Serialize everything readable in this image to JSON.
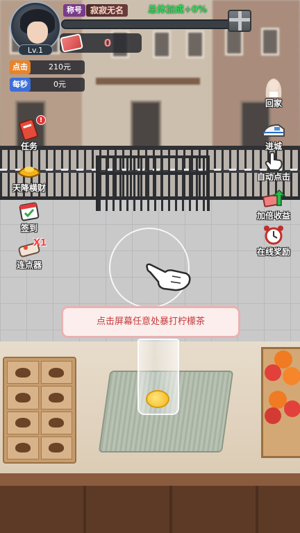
{
  "player": {
    "title_tag": "称号",
    "name": "寂寂无名",
    "level": "Lv.1",
    "total_bonus": "总体加成+0%",
    "xp_progress": 0
  },
  "currency": {
    "cash_value": "0"
  },
  "stats": {
    "click_label": "点击",
    "click_value": "210元",
    "per_second_label": "每秒",
    "per_second_value": "0元"
  },
  "left_menu": [
    {
      "label": "任务",
      "icon": "task-scroll-icon",
      "badge": "!"
    },
    {
      "label": "天降横财",
      "icon": "gold-ingot-icon"
    },
    {
      "label": "签到",
      "icon": "calendar-checkin-icon"
    },
    {
      "label": "连点器",
      "icon": "auto-clicker-icon",
      "multiplier": "X1"
    }
  ],
  "right_menu": [
    {
      "label": "回家",
      "icon": "girl-portrait-icon"
    },
    {
      "label": "进城",
      "icon": "train-icon"
    },
    {
      "label": "自动点击",
      "icon": "tap-hand-icon"
    },
    {
      "label": "加倍收益",
      "icon": "double-income-icon"
    },
    {
      "label": "在线奖励",
      "icon": "alarm-clock-icon"
    }
  ],
  "hint": {
    "text": "点击屏幕任意处暴打柠檬茶"
  },
  "colors": {
    "bonus_green": "#31d85b",
    "hint_red": "#c53a3a",
    "cash_red": "#ff8a8a"
  }
}
